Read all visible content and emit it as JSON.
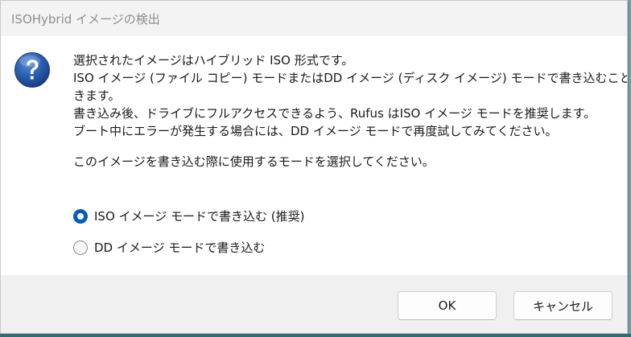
{
  "window": {
    "title": "ISOHybrid イメージの検出"
  },
  "message": {
    "icon": "question-icon",
    "lines": [
      "選択されたイメージはハイブリッド ISO 形式です。",
      "ISO イメージ (ファイル コピー) モードまたはDD イメージ (ディスク イメージ) モードで書き込むことがで",
      "きます。",
      "書き込み後、ドライブにフルアクセスできるよう、Rufus はISO イメージ モードを推奨します。",
      "ブート中にエラーが発生する場合には、DD イメージ モードで再度試してみてください。"
    ],
    "prompt": "このイメージを書き込む際に使用するモードを選択してください。"
  },
  "options": [
    {
      "label": "ISO イメージ モードで書き込む (推奨)",
      "selected": true
    },
    {
      "label": "DD イメージ モードで書き込む",
      "selected": false
    }
  ],
  "buttons": {
    "ok": "OK",
    "cancel": "キャンセル"
  },
  "colors": {
    "accent": "#005fb8",
    "icon_blue": "#1b4f9c"
  }
}
